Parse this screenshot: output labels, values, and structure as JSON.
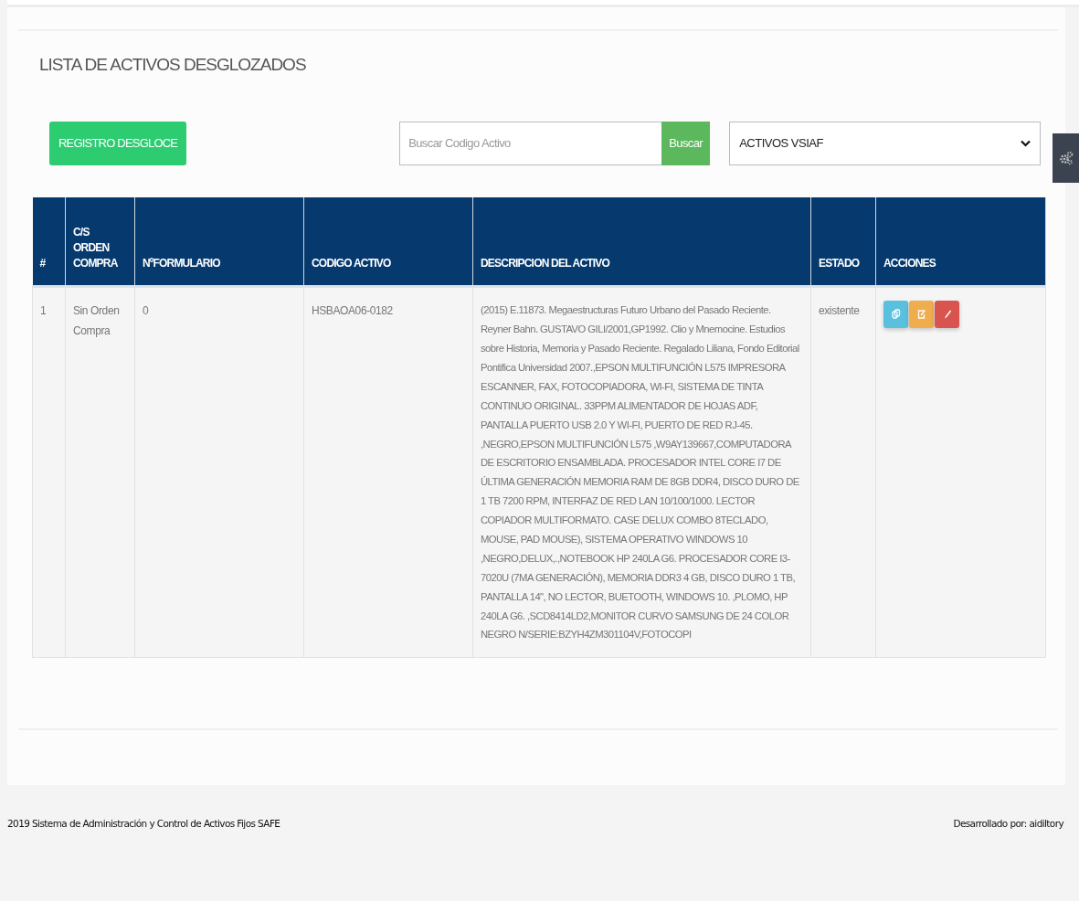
{
  "page_title": "LISTA DE ACTIVOS DESGLOZADOS",
  "toolbar": {
    "register_button": "REGISTRO DESGLOCE",
    "search": {
      "placeholder": "Buscar Codigo Activo",
      "button": "Buscar"
    },
    "filter_select": {
      "value": "ACTIVOS VSIAF"
    }
  },
  "table": {
    "columns": [
      "#",
      "C/S ORDEN COMPRA",
      "NºFORMULARIO",
      "CODIGO ACTIVO",
      "DESCRIPCION DEL ACTIVO",
      "ESTADO",
      "ACCIONES"
    ],
    "rows": [
      {
        "cells": [
          "1",
          "Sin Orden Compra",
          "0",
          "HSBAOA06-0182",
          "(2015) E.11873. Megaestructuras Futuro Urbano del Pasado Reciente. Reyner Bahn. GUSTAVO GILI/2001,GP1992. Clio y Mnemocine. Estudios sobre Historia, Memoria y Pasado Reciente. Regalado Liliana, Fondo Editorial Pontifica Universidad 2007.,EPSON MULTIFUNCIÓN L575 IMPRESORA ESCANNER, FAX, FOTOCOPIADORA, WI-FI, SISTEMA DE TINTA CONTINUO ORIGINAL. 33PPM ALIMENTADOR DE HOJAS ADF, PANTALLA PUERTO USB 2.0 Y WI-FI, PUERTO DE RED RJ-45. ,NEGRO,EPSON MULTIFUNCIÓN L575 ,W9AY139667,COMPUTADORA DE ESCRITORIO ENSAMBLADA. PROCESADOR INTEL CORE I7 DE ÚLTIMA GENERACIÓN MEMORIA RAM DE 8GB DDR4, DISCO DURO DE 1 TB 7200 RPM, INTERFAZ DE RED LAN 10/100/1000. LECTOR COPIADOR MULTIFORMATO. CASE DELUX COMBO 8TECLADO, MOUSE, PAD MOUSE), SISTEMA OPERATIVO WINDOWS 10 ,NEGRO,DELUX,.,NOTEBOOK HP 240LA G6. PROCESADOR CORE I3-7020U (7MA GENERACIÓN), MEMORIA DDR3 4 GB, DISCO DURO 1 TB, PANTALLA 14\", NO LECTOR, BUETOOTH, WINDOWS 10. ,PLOMO, HP 240LA G6. ,SCD8414LD2,MONITOR CURVO SAMSUNG DE 24 COLOR NEGRO N/SERIE:BZYH4ZM301104V,FOTOCOPI",
          "existente"
        ],
        "actions": [
          {
            "kind": "copy"
          },
          {
            "kind": "edit"
          },
          {
            "kind": "delete"
          }
        ]
      }
    ]
  },
  "footer": {
    "left": "2019 Sistema de Administración y Control de Activos Fijos SAFE",
    "right": "Desarrollado por: aidiltory"
  }
}
